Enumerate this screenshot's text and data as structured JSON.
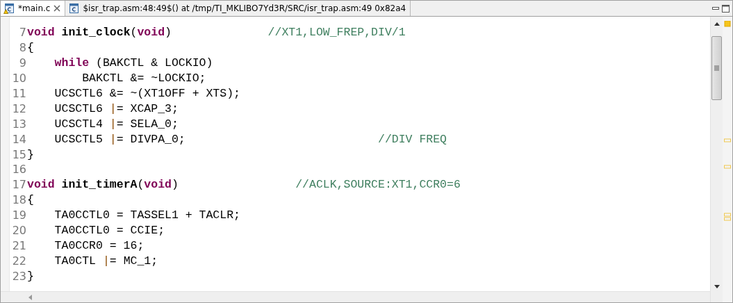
{
  "tabs": [
    {
      "label": "*main.c",
      "selected": true,
      "warning": true,
      "closable": true
    },
    {
      "label": "$isr_trap.asm:48:49$() at /tmp/TI_MKLIBO7Yd3R/SRC/isr_trap.asm:49 0x82a4",
      "selected": false,
      "warning": false,
      "closable": false
    }
  ],
  "lines": [
    {
      "number": "7",
      "tokens": [
        {
          "kind": "keyword",
          "text": "void"
        },
        {
          "kind": "function",
          "text": " init_clock"
        },
        {
          "kind": "plain",
          "text": "("
        },
        {
          "kind": "keyword",
          "text": "void"
        },
        {
          "kind": "plain",
          "text": ")              "
        },
        {
          "kind": "comment",
          "text": "//XT1,LOW_FREP,DIV/1"
        }
      ]
    },
    {
      "number": "8",
      "tokens": [
        {
          "kind": "plain",
          "text": "{"
        }
      ]
    },
    {
      "number": "9",
      "tokens": [
        {
          "kind": "keyword",
          "text": "    while"
        },
        {
          "kind": "plain",
          "text": " (BAKCTL & LOCKIO)"
        }
      ]
    },
    {
      "number": "10",
      "tokens": [
        {
          "kind": "plain",
          "text": "        BAKCTL &= ~LOCKIO;"
        }
      ]
    },
    {
      "number": "11",
      "tokens": [
        {
          "kind": "plain",
          "text": "    UCSCTL6 &= ~(XT1OFF + XTS);"
        }
      ]
    },
    {
      "number": "12",
      "tokens": [
        {
          "kind": "plain",
          "text": "    UCSCTL6 "
        },
        {
          "kind": "pipe",
          "text": "|"
        },
        {
          "kind": "plain",
          "text": "= XCAP_3;"
        }
      ]
    },
    {
      "number": "13",
      "tokens": [
        {
          "kind": "plain",
          "text": "    UCSCTL4 "
        },
        {
          "kind": "pipe",
          "text": "|"
        },
        {
          "kind": "plain",
          "text": "= SELA_0;"
        }
      ]
    },
    {
      "number": "14",
      "tokens": [
        {
          "kind": "plain",
          "text": "    UCSCTL5 "
        },
        {
          "kind": "pipe",
          "text": "|"
        },
        {
          "kind": "plain",
          "text": "= DIVPA_0;                            "
        },
        {
          "kind": "comment",
          "text": "//DIV FREQ"
        }
      ]
    },
    {
      "number": "15",
      "tokens": [
        {
          "kind": "plain",
          "text": "}"
        }
      ]
    },
    {
      "number": "16"
    },
    {
      "number": "17",
      "tokens": [
        {
          "kind": "keyword",
          "text": "void"
        },
        {
          "kind": "function",
          "text": " init_timerA"
        },
        {
          "kind": "plain",
          "text": "("
        },
        {
          "kind": "keyword",
          "text": "void"
        },
        {
          "kind": "plain",
          "text": ")                 "
        },
        {
          "kind": "comment",
          "text": "//ACLK,SOURCE:XT1,CCR0=6"
        }
      ]
    },
    {
      "number": "18",
      "tokens": [
        {
          "kind": "plain",
          "text": "{"
        }
      ]
    },
    {
      "number": "19",
      "tokens": [
        {
          "kind": "plain",
          "text": "    TA0CCTL0 = TASSEL1 + TACLR;"
        }
      ]
    },
    {
      "number": "20",
      "tokens": [
        {
          "kind": "plain",
          "text": "    TA0CCTL0 = CCIE;"
        }
      ]
    },
    {
      "number": "21",
      "tokens": [
        {
          "kind": "plain",
          "text": "    TA0CCR0 = 16;"
        }
      ]
    },
    {
      "number": "22",
      "tokens": [
        {
          "kind": "plain",
          "text": "    TA0CTL "
        },
        {
          "kind": "pipe",
          "text": "|"
        },
        {
          "kind": "plain",
          "text": "= MC_1;"
        }
      ]
    },
    {
      "number": "23",
      "tokens": [
        {
          "kind": "plain",
          "text": "}"
        }
      ]
    }
  ]
}
